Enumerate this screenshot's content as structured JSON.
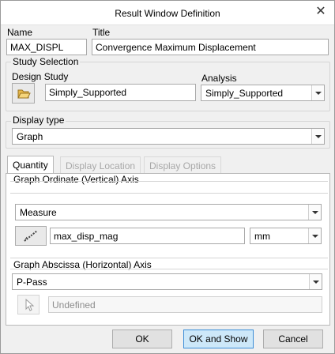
{
  "window": {
    "title": "Result Window Definition",
    "close_glyph": "✕"
  },
  "name": {
    "label": "Name",
    "value": "MAX_DISPL"
  },
  "title_field": {
    "label": "Title",
    "value": "Convergence Maximum Displacement"
  },
  "study_selection": {
    "group_title": "Study Selection",
    "design_study_label": "Design Study",
    "design_study_value": "Simply_Supported",
    "open_icon": "folder-open-icon",
    "analysis_label": "Analysis",
    "analysis_value": "Simply_Supported"
  },
  "display_type": {
    "group_title": "Display type",
    "value": "Graph"
  },
  "tabs": [
    {
      "label": "Quantity",
      "active": true
    },
    {
      "label": "Display Location",
      "active": false
    },
    {
      "label": "Display Options",
      "active": false
    }
  ],
  "ordinate": {
    "group_title": "Graph Ordinate (Vertical) Axis",
    "measure_value": "Measure",
    "picker_icon": "measure-picker-icon",
    "quantity_value": "max_disp_mag",
    "units_value": "mm"
  },
  "abscissa": {
    "group_title": "Graph Abscissa (Horizontal) Axis",
    "value": "P-Pass",
    "select_icon": "cursor-select-icon",
    "selection_value": "Undefined"
  },
  "buttons": {
    "ok": "OK",
    "ok_and_show": "OK and Show",
    "cancel": "Cancel"
  },
  "colors": {
    "accent": "#3c8ed8",
    "default_button_bg": "#cde8f9"
  }
}
